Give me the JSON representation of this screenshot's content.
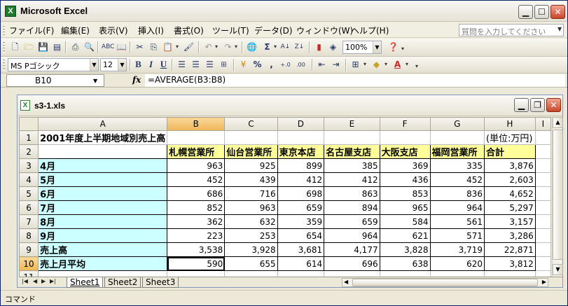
{
  "app": {
    "title": "Microsoft Excel",
    "icon_letter": "X"
  },
  "menu": {
    "items": [
      "ファイル(F)",
      "編集(E)",
      "表示(V)",
      "挿入(I)",
      "書式(O)",
      "ツール(T)",
      "データ(D)",
      "ウィンドウ(W)",
      "ヘルプ(H)"
    ],
    "help_placeholder": "質問を入力してください"
  },
  "toolbar": {
    "zoom": "100%",
    "font_name": "MS Pゴシック",
    "font_size": "12",
    "bold": "B",
    "italic": "I",
    "underline": "U",
    "percent": "%",
    "comma": ",",
    "sigma": "Σ"
  },
  "formula_bar": {
    "name_box": "B10",
    "fx": "fx",
    "formula": "=AVERAGE(B3:B8)"
  },
  "workbook": {
    "title": "s3-1.xls",
    "icon_letter": "X"
  },
  "grid": {
    "columns": [
      "A",
      "B",
      "C",
      "D",
      "E",
      "F",
      "G",
      "H",
      "I"
    ],
    "rows": [
      {
        "num": "1",
        "cells": [
          "2001年度上半期地域別売上高",
          "",
          "",
          "",
          "",
          "",
          "",
          "(単位:万円)"
        ]
      },
      {
        "num": "2",
        "cells": [
          "",
          "札幌営業所",
          "仙台営業所",
          "東京本店",
          "名古屋支店",
          "大阪支店",
          "福岡営業所",
          "合計"
        ]
      },
      {
        "num": "3",
        "cells": [
          "4月",
          "963",
          "925",
          "899",
          "385",
          "369",
          "335",
          "3,876"
        ]
      },
      {
        "num": "4",
        "cells": [
          "5月",
          "452",
          "439",
          "412",
          "412",
          "436",
          "452",
          "2,603"
        ]
      },
      {
        "num": "5",
        "cells": [
          "6月",
          "686",
          "716",
          "698",
          "863",
          "853",
          "836",
          "4,652"
        ]
      },
      {
        "num": "6",
        "cells": [
          "7月",
          "852",
          "963",
          "659",
          "894",
          "965",
          "964",
          "5,297"
        ]
      },
      {
        "num": "7",
        "cells": [
          "8月",
          "362",
          "632",
          "359",
          "659",
          "584",
          "561",
          "3,157"
        ]
      },
      {
        "num": "8",
        "cells": [
          "9月",
          "223",
          "253",
          "654",
          "964",
          "621",
          "571",
          "3,286"
        ]
      },
      {
        "num": "9",
        "cells": [
          "売上高",
          "3,538",
          "3,928",
          "3,681",
          "4,177",
          "3,828",
          "3,719",
          "22,871"
        ]
      },
      {
        "num": "10",
        "cells": [
          "売上月平均",
          "590",
          "655",
          "614",
          "696",
          "638",
          "620",
          "3,812"
        ]
      },
      {
        "num": "11",
        "cells": [
          "",
          "",
          "",
          "",
          "",
          "",
          "",
          ""
        ]
      }
    ]
  },
  "sheets": {
    "tabs": [
      "Sheet1",
      "Sheet2",
      "Sheet3"
    ],
    "active": "Sheet1"
  },
  "status": {
    "text": "コマンド"
  }
}
